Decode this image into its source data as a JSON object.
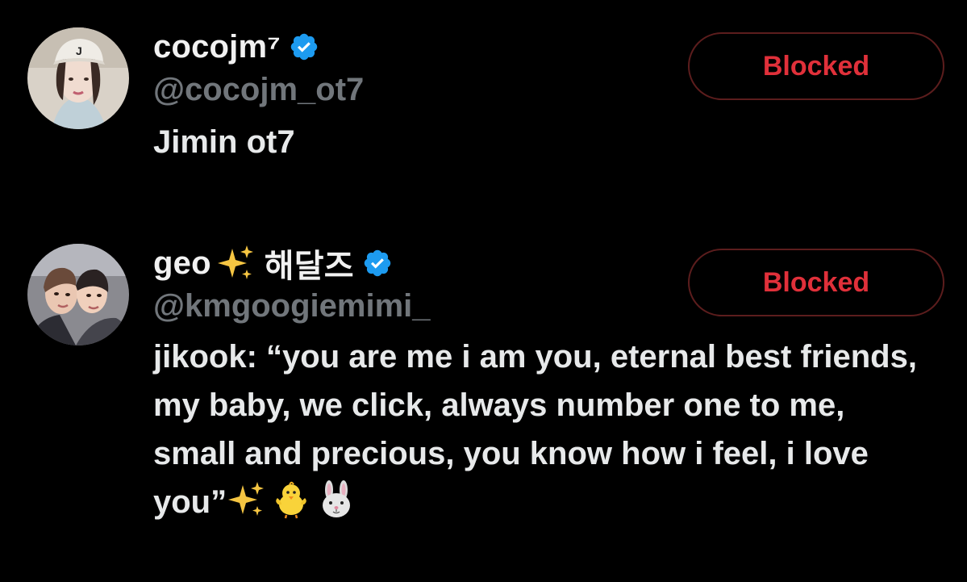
{
  "users": [
    {
      "display_name": "cocojm⁷",
      "handle": "@cocojm_ot7",
      "bio": "Jimin ot7",
      "verified": true,
      "button_label": "Blocked"
    },
    {
      "display_name": "geo",
      "display_name_suffix": "해달즈",
      "handle": "@kmgoogiemimi_",
      "bio": "jikook: “you are me i am you, eternal best friends, my baby, we click, always number one to me, small and precious, you know how i feel, i love you”",
      "verified": true,
      "button_label": "Blocked",
      "name_emoji": "sparkles-icon",
      "bio_emojis": [
        "sparkles-icon",
        "chick-icon",
        "rabbit-icon"
      ]
    }
  ],
  "colors": {
    "background": "#000000",
    "text": "#e7e9ea",
    "handle": "#71767b",
    "verified": "#1d9bf0",
    "blocked_text": "#e0303a",
    "blocked_border": "#5c1d1d"
  }
}
